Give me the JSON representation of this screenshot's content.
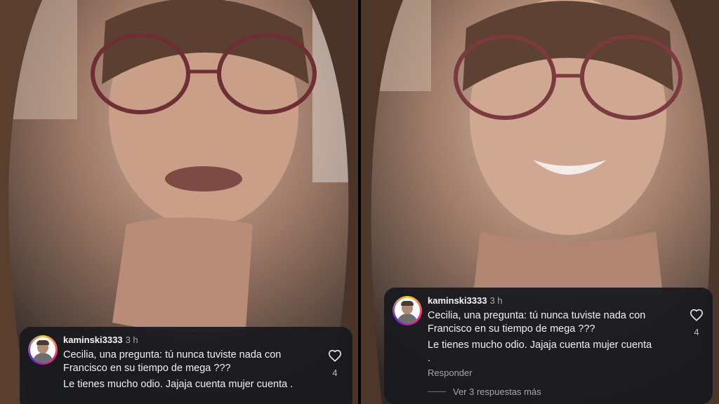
{
  "panels": [
    {
      "username": "kaminski3333",
      "time": "3 h",
      "comment_line1": "Cecilia, una pregunta: tú nunca tuviste nada con Francisco en su tiempo de mega ???",
      "comment_line2": "Le tienes mucho odio. Jajaja cuenta mujer cuenta .",
      "likes": "4"
    },
    {
      "username": "kaminski3333",
      "time": "3 h",
      "comment_line1": "Cecilia, una pregunta: tú nunca tuviste nada con Francisco en su tiempo de mega ???",
      "comment_line2": "Le tienes mucho odio. Jajaja cuenta mujer cuenta .",
      "likes": "4",
      "reply_label": "Responder",
      "view_replies": "Ver 3 respuestas más"
    }
  ],
  "icons": {
    "avatar": "user-avatar",
    "like": "heart-icon"
  },
  "colors": {
    "card_bg": "#18191e",
    "muted_text": "#a8a8a8",
    "text": "#f1f1f1"
  }
}
